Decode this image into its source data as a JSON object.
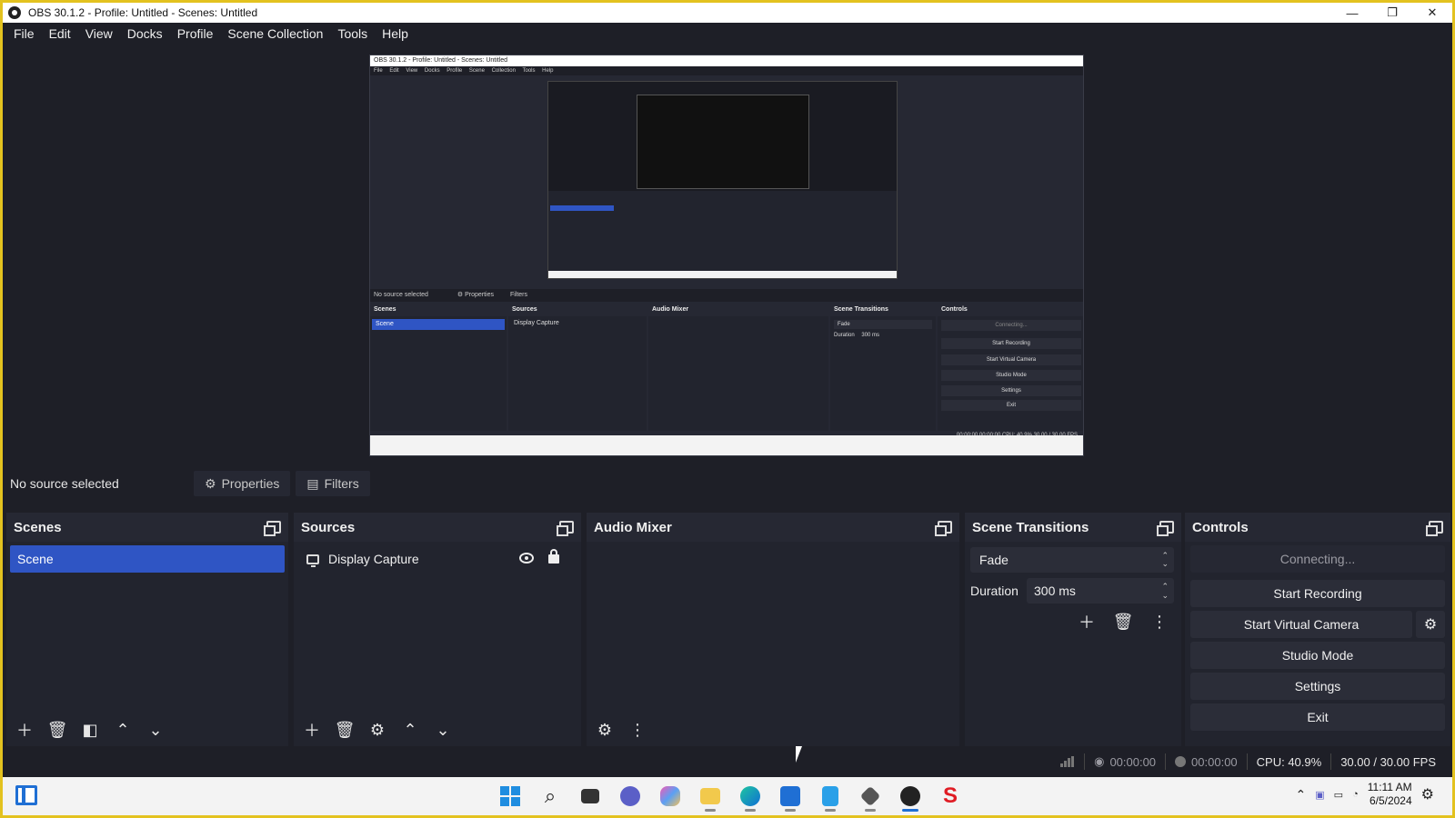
{
  "window": {
    "title": "OBS 30.1.2 - Profile: Untitled - Scenes: Untitled",
    "minimize": "—",
    "restore": "❐",
    "close": "✕"
  },
  "menu": [
    "File",
    "Edit",
    "View",
    "Docks",
    "Profile",
    "Scene Collection",
    "Tools",
    "Help"
  ],
  "source_toolbar": {
    "status": "No source selected",
    "properties": "Properties",
    "filters": "Filters"
  },
  "scenes": {
    "title": "Scenes",
    "items": [
      "Scene"
    ]
  },
  "sources": {
    "title": "Sources",
    "items": [
      "Display Capture"
    ]
  },
  "audio_mixer": {
    "title": "Audio Mixer"
  },
  "scene_transitions": {
    "title": "Scene Transitions",
    "selected": "Fade",
    "duration_label": "Duration",
    "duration_value": "300 ms"
  },
  "controls": {
    "title": "Controls",
    "connecting": "Connecting...",
    "start_recording": "Start Recording",
    "start_virtual_camera": "Start Virtual Camera",
    "studio_mode": "Studio Mode",
    "settings": "Settings",
    "exit": "Exit"
  },
  "status": {
    "stream_time": "00:00:00",
    "record_time": "00:00:00",
    "cpu": "CPU: 40.9%",
    "fps": "30.00 / 30.00 FPS"
  },
  "taskbar": {
    "time": "11:11 AM",
    "date": "6/5/2024"
  },
  "preview": {
    "title": "OBS 30.1.2 - Profile: Untitled - Scenes: Untitled",
    "menu": "File Edit View Docks Profile Scene Collection Tools Help",
    "status": "No source selected",
    "properties": "⚙ Properties",
    "filters": "Filters",
    "scenes": "Scenes",
    "sources": "Sources",
    "audio_mixer": "Audio Mixer",
    "scene_transitions": "Scene Transitions",
    "controls": "Controls",
    "scene_item": "Scene",
    "source_item": "Display Capture",
    "fade": "Fade",
    "duration": "Duration",
    "duration_value": "300 ms",
    "connecting": "Connecting...",
    "start_recording": "Start Recording",
    "start_virtual_camera": "Start Virtual Camera",
    "studio_mode": "Studio Mode",
    "settings": "Settings",
    "exit": "Exit",
    "status_right": "00:00:00   00:00:00   CPU: 40.9%   30.00 / 30.00 FPS"
  },
  "colors": {
    "accent": "#2f55c4",
    "window_border": "#e3c21f",
    "background": "#1e1f27",
    "panel": "#22242e"
  }
}
